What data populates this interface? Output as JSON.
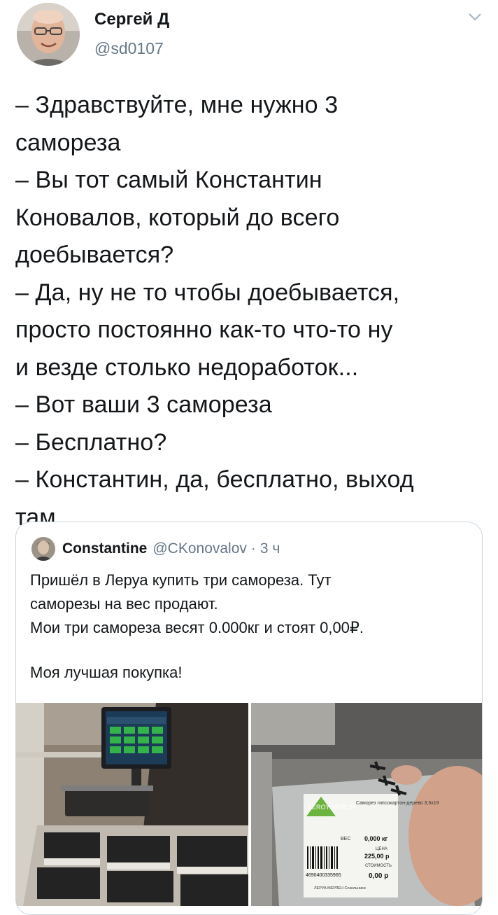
{
  "author": {
    "name": "Сергей Д",
    "handle": "@sd0107"
  },
  "menu_icon": "chevron-down-icon",
  "tweet": {
    "lines": [
      "– Здравствуйте, мне нужно 3",
      "самореза",
      "– Вы тот самый Константин",
      "Коновалов, который до всего",
      "доебывается?",
      "– Да, ну не то чтобы доебывается,",
      "просто постоянно как-то что-то ну",
      "и везде столько недоработок...",
      "– Вот ваши 3 самореза",
      "– Бесплатно?",
      "– Константин, да, бесплатно, выход",
      "там."
    ]
  },
  "quoted": {
    "name": "Constantine",
    "handle": "@CKonovalov",
    "separator": "·",
    "time": "3 ч",
    "lines": [
      "Пришёл в Леруа купить три самореза. Тут",
      "саморезы на вес продают.",
      "Мои три самореза весят 0.000кг и стоят 0,00₽."
    ],
    "footer_line": "Моя лучшая покупка!",
    "label": {
      "title": "Саморез\nгипсокартон-дерево\n3,5х19",
      "weight_label": "ВЕС",
      "weight": "0,000 кг",
      "price_label": "ЦЕНА",
      "price": "225,00 р",
      "total_label": "СТОИМОСТЬ",
      "total": "0,00 р",
      "barcode": "4690400335965",
      "store": "ЛЕРУА МЕРЛЕН Сокольники",
      "brand": "LEROY MERLIN"
    }
  },
  "colors": {
    "text": "#14171a",
    "secondary": "#657786",
    "border": "#ccd6dd",
    "brand_green": "#6cb33f"
  }
}
